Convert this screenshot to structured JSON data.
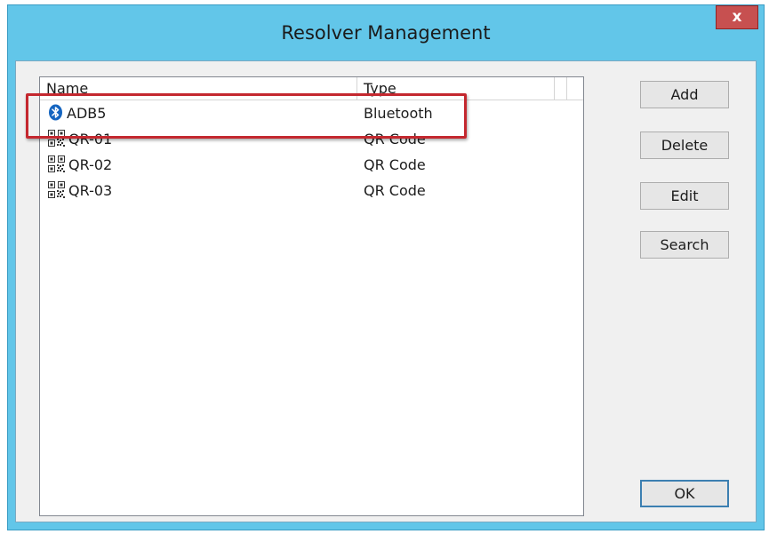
{
  "window": {
    "title": "Resolver Management",
    "close_label": "x"
  },
  "listview": {
    "columns": [
      "Name",
      "Type"
    ],
    "rows": [
      {
        "name": "ADB5",
        "type": "Bluetooth",
        "icon": "bluetooth-icon",
        "selected": true
      },
      {
        "name": "QR-01",
        "type": "QR Code",
        "icon": "qr-code-icon"
      },
      {
        "name": "QR-02",
        "type": "QR Code",
        "icon": "qr-code-icon"
      },
      {
        "name": "QR-03",
        "type": "QR Code",
        "icon": "qr-code-icon"
      }
    ]
  },
  "buttons": {
    "add": "Add",
    "delete": "Delete",
    "edit": "Edit",
    "search": "Search",
    "ok": "OK"
  },
  "colors": {
    "title_bar": "#62c6e9",
    "close_button": "#c75050",
    "highlight_border": "#c4282f",
    "bluetooth": "#1565c0"
  }
}
